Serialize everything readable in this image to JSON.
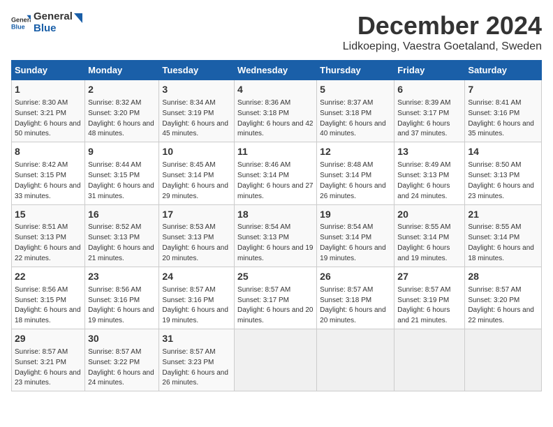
{
  "logo": {
    "line1": "General",
    "line2": "Blue"
  },
  "title": "December 2024",
  "subtitle": "Lidkoeping, Vaestra Goetaland, Sweden",
  "days_header": [
    "Sunday",
    "Monday",
    "Tuesday",
    "Wednesday",
    "Thursday",
    "Friday",
    "Saturday"
  ],
  "weeks": [
    [
      {
        "day": "1",
        "sunrise": "Sunrise: 8:30 AM",
        "sunset": "Sunset: 3:21 PM",
        "daylight": "Daylight: 6 hours and 50 minutes."
      },
      {
        "day": "2",
        "sunrise": "Sunrise: 8:32 AM",
        "sunset": "Sunset: 3:20 PM",
        "daylight": "Daylight: 6 hours and 48 minutes."
      },
      {
        "day": "3",
        "sunrise": "Sunrise: 8:34 AM",
        "sunset": "Sunset: 3:19 PM",
        "daylight": "Daylight: 6 hours and 45 minutes."
      },
      {
        "day": "4",
        "sunrise": "Sunrise: 8:36 AM",
        "sunset": "Sunset: 3:18 PM",
        "daylight": "Daylight: 6 hours and 42 minutes."
      },
      {
        "day": "5",
        "sunrise": "Sunrise: 8:37 AM",
        "sunset": "Sunset: 3:18 PM",
        "daylight": "Daylight: 6 hours and 40 minutes."
      },
      {
        "day": "6",
        "sunrise": "Sunrise: 8:39 AM",
        "sunset": "Sunset: 3:17 PM",
        "daylight": "Daylight: 6 hours and 37 minutes."
      },
      {
        "day": "7",
        "sunrise": "Sunrise: 8:41 AM",
        "sunset": "Sunset: 3:16 PM",
        "daylight": "Daylight: 6 hours and 35 minutes."
      }
    ],
    [
      {
        "day": "8",
        "sunrise": "Sunrise: 8:42 AM",
        "sunset": "Sunset: 3:15 PM",
        "daylight": "Daylight: 6 hours and 33 minutes."
      },
      {
        "day": "9",
        "sunrise": "Sunrise: 8:44 AM",
        "sunset": "Sunset: 3:15 PM",
        "daylight": "Daylight: 6 hours and 31 minutes."
      },
      {
        "day": "10",
        "sunrise": "Sunrise: 8:45 AM",
        "sunset": "Sunset: 3:14 PM",
        "daylight": "Daylight: 6 hours and 29 minutes."
      },
      {
        "day": "11",
        "sunrise": "Sunrise: 8:46 AM",
        "sunset": "Sunset: 3:14 PM",
        "daylight": "Daylight: 6 hours and 27 minutes."
      },
      {
        "day": "12",
        "sunrise": "Sunrise: 8:48 AM",
        "sunset": "Sunset: 3:14 PM",
        "daylight": "Daylight: 6 hours and 26 minutes."
      },
      {
        "day": "13",
        "sunrise": "Sunrise: 8:49 AM",
        "sunset": "Sunset: 3:13 PM",
        "daylight": "Daylight: 6 hours and 24 minutes."
      },
      {
        "day": "14",
        "sunrise": "Sunrise: 8:50 AM",
        "sunset": "Sunset: 3:13 PM",
        "daylight": "Daylight: 6 hours and 23 minutes."
      }
    ],
    [
      {
        "day": "15",
        "sunrise": "Sunrise: 8:51 AM",
        "sunset": "Sunset: 3:13 PM",
        "daylight": "Daylight: 6 hours and 22 minutes."
      },
      {
        "day": "16",
        "sunrise": "Sunrise: 8:52 AM",
        "sunset": "Sunset: 3:13 PM",
        "daylight": "Daylight: 6 hours and 21 minutes."
      },
      {
        "day": "17",
        "sunrise": "Sunrise: 8:53 AM",
        "sunset": "Sunset: 3:13 PM",
        "daylight": "Daylight: 6 hours and 20 minutes."
      },
      {
        "day": "18",
        "sunrise": "Sunrise: 8:54 AM",
        "sunset": "Sunset: 3:13 PM",
        "daylight": "Daylight: 6 hours and 19 minutes."
      },
      {
        "day": "19",
        "sunrise": "Sunrise: 8:54 AM",
        "sunset": "Sunset: 3:14 PM",
        "daylight": "Daylight: 6 hours and 19 minutes."
      },
      {
        "day": "20",
        "sunrise": "Sunrise: 8:55 AM",
        "sunset": "Sunset: 3:14 PM",
        "daylight": "Daylight: 6 hours and 19 minutes."
      },
      {
        "day": "21",
        "sunrise": "Sunrise: 8:55 AM",
        "sunset": "Sunset: 3:14 PM",
        "daylight": "Daylight: 6 hours and 18 minutes."
      }
    ],
    [
      {
        "day": "22",
        "sunrise": "Sunrise: 8:56 AM",
        "sunset": "Sunset: 3:15 PM",
        "daylight": "Daylight: 6 hours and 18 minutes."
      },
      {
        "day": "23",
        "sunrise": "Sunrise: 8:56 AM",
        "sunset": "Sunset: 3:16 PM",
        "daylight": "Daylight: 6 hours and 19 minutes."
      },
      {
        "day": "24",
        "sunrise": "Sunrise: 8:57 AM",
        "sunset": "Sunset: 3:16 PM",
        "daylight": "Daylight: 6 hours and 19 minutes."
      },
      {
        "day": "25",
        "sunrise": "Sunrise: 8:57 AM",
        "sunset": "Sunset: 3:17 PM",
        "daylight": "Daylight: 6 hours and 20 minutes."
      },
      {
        "day": "26",
        "sunrise": "Sunrise: 8:57 AM",
        "sunset": "Sunset: 3:18 PM",
        "daylight": "Daylight: 6 hours and 20 minutes."
      },
      {
        "day": "27",
        "sunrise": "Sunrise: 8:57 AM",
        "sunset": "Sunset: 3:19 PM",
        "daylight": "Daylight: 6 hours and 21 minutes."
      },
      {
        "day": "28",
        "sunrise": "Sunrise: 8:57 AM",
        "sunset": "Sunset: 3:20 PM",
        "daylight": "Daylight: 6 hours and 22 minutes."
      }
    ],
    [
      {
        "day": "29",
        "sunrise": "Sunrise: 8:57 AM",
        "sunset": "Sunset: 3:21 PM",
        "daylight": "Daylight: 6 hours and 23 minutes."
      },
      {
        "day": "30",
        "sunrise": "Sunrise: 8:57 AM",
        "sunset": "Sunset: 3:22 PM",
        "daylight": "Daylight: 6 hours and 24 minutes."
      },
      {
        "day": "31",
        "sunrise": "Sunrise: 8:57 AM",
        "sunset": "Sunset: 3:23 PM",
        "daylight": "Daylight: 6 hours and 26 minutes."
      },
      null,
      null,
      null,
      null
    ]
  ]
}
